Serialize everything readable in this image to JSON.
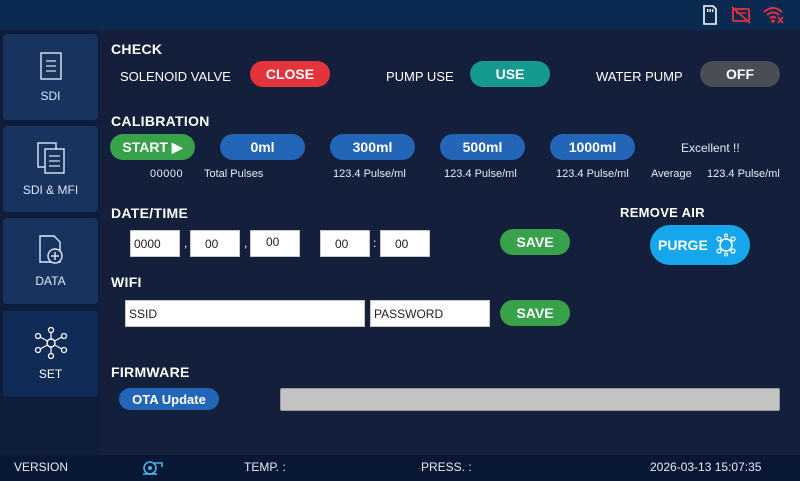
{
  "topbar": {
    "icons": [
      "sd-card-icon",
      "disconnected-icon",
      "wifi-off-icon"
    ]
  },
  "sidebar": {
    "items": [
      {
        "label": "SDI",
        "icon": "document-icon"
      },
      {
        "label": "SDI & MFI",
        "icon": "documents-icon"
      },
      {
        "label": "DATA",
        "icon": "data-add-icon"
      },
      {
        "label": "SET",
        "icon": "network-icon"
      }
    ]
  },
  "check": {
    "title": "CHECK",
    "solenoid_label": "SOLENOID VALVE",
    "solenoid_state": "CLOSE",
    "pump_label": "PUMP USE",
    "pump_state": "USE",
    "water_label": "WATER  PUMP",
    "water_state": "OFF"
  },
  "calibration": {
    "title": "CALIBRATION",
    "start_label": "START ▶",
    "buttons": [
      "0ml",
      "300ml",
      "500ml",
      "1000ml"
    ],
    "status": "Excellent !!",
    "pulses": "00000",
    "pulses_label": "Total Pulses",
    "readings": [
      "123.4 Pulse/ml",
      "123.4 Pulse/ml",
      "123.4 Pulse/ml"
    ],
    "average_label": "Average",
    "average_value": "123.4 Pulse/ml"
  },
  "datetime": {
    "title": "DATE/TIME",
    "year": "0000",
    "month": "00",
    "day": "00",
    "hour": "00",
    "minute": "00",
    "sep_date": ",",
    "sep_time": ":",
    "save_label": "SAVE"
  },
  "remove_air": {
    "title": "REMOVE AIR",
    "purge_label": "PURGE"
  },
  "wifi": {
    "title": "WIFI",
    "ssid_placeholder": "SSID",
    "password_placeholder": "PASSWORD",
    "save_label": "SAVE"
  },
  "firmware": {
    "title": "FIRMWARE",
    "ota_label": "OTA Update",
    "progress": 0.0
  },
  "status": {
    "version_label": "VERSION",
    "temp_label": "TEMP. :",
    "press_label": "PRESS. :",
    "datetime": "2026-03-13 15:07:35"
  },
  "colors": {
    "accent_blue": "#2366b8",
    "save_green": "#38a24a",
    "close_red": "#e2343a",
    "use_teal": "#16998f"
  }
}
